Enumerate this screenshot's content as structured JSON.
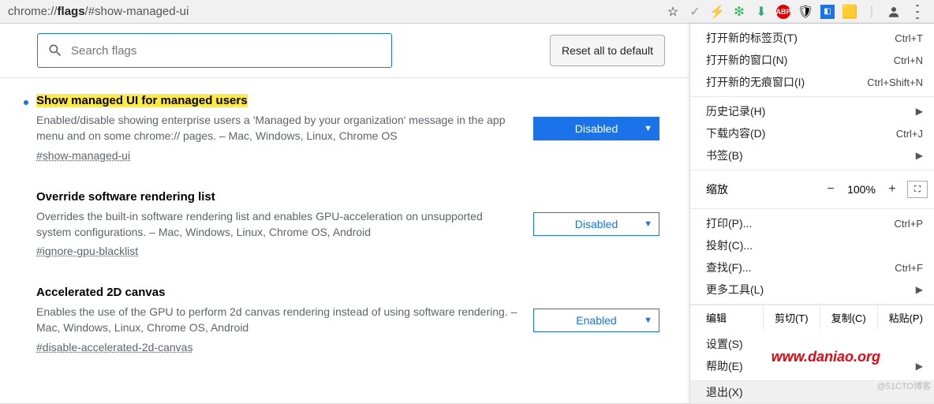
{
  "toolbar": {
    "url_prefix": "chrome://",
    "url_bold": "flags",
    "url_suffix": "/#show-managed-ui"
  },
  "search": {
    "placeholder": "Search flags"
  },
  "reset_label": "Reset all to default",
  "flags": [
    {
      "title": "Show managed UI for managed users",
      "desc": "Enabled/disable showing enterprise users a 'Managed by your organization' message in the app menu and on some chrome:// pages. – Mac, Windows, Linux, Chrome OS",
      "anchor": "#show-managed-ui",
      "value": "Disabled",
      "highlighted": true,
      "filled": true
    },
    {
      "title": "Override software rendering list",
      "desc": "Overrides the built-in software rendering list and enables GPU-acceleration on unsupported system configurations. – Mac, Windows, Linux, Chrome OS, Android",
      "anchor": "#ignore-gpu-blacklist",
      "value": "Disabled",
      "highlighted": false,
      "filled": false
    },
    {
      "title": "Accelerated 2D canvas",
      "desc": "Enables the use of the GPU to perform 2d canvas rendering instead of using software rendering. – Mac, Windows, Linux, Chrome OS, Android",
      "anchor": "#disable-accelerated-2d-canvas",
      "value": "Enabled",
      "highlighted": false,
      "filled": false
    }
  ],
  "menu": {
    "sec1": [
      {
        "label": "打开新的标签页(T)",
        "shortcut": "Ctrl+T"
      },
      {
        "label": "打开新的窗口(N)",
        "shortcut": "Ctrl+N"
      },
      {
        "label": "打开新的无痕窗口(I)",
        "shortcut": "Ctrl+Shift+N"
      }
    ],
    "sec2": [
      {
        "label": "历史记录(H)",
        "arrow": true
      },
      {
        "label": "下载内容(D)",
        "shortcut": "Ctrl+J"
      },
      {
        "label": "书签(B)",
        "arrow": true
      }
    ],
    "zoom": {
      "label": "缩放",
      "minus": "−",
      "pct": "100%",
      "plus": "+",
      "full": "⛶"
    },
    "sec3": [
      {
        "label": "打印(P)...",
        "shortcut": "Ctrl+P"
      },
      {
        "label": "投射(C)..."
      },
      {
        "label": "查找(F)...",
        "shortcut": "Ctrl+F"
      },
      {
        "label": "更多工具(L)",
        "arrow": true
      }
    ],
    "edit": {
      "label": "编辑",
      "cut": "剪切(T)",
      "copy": "复制(C)",
      "paste": "粘贴(P)"
    },
    "sec4": [
      {
        "label": "设置(S)"
      },
      {
        "label": "帮助(E)",
        "arrow": true
      }
    ],
    "exit": {
      "label": "退出(X)"
    }
  },
  "watermark": "www.daniao.org",
  "cto": "@51CTO博客"
}
